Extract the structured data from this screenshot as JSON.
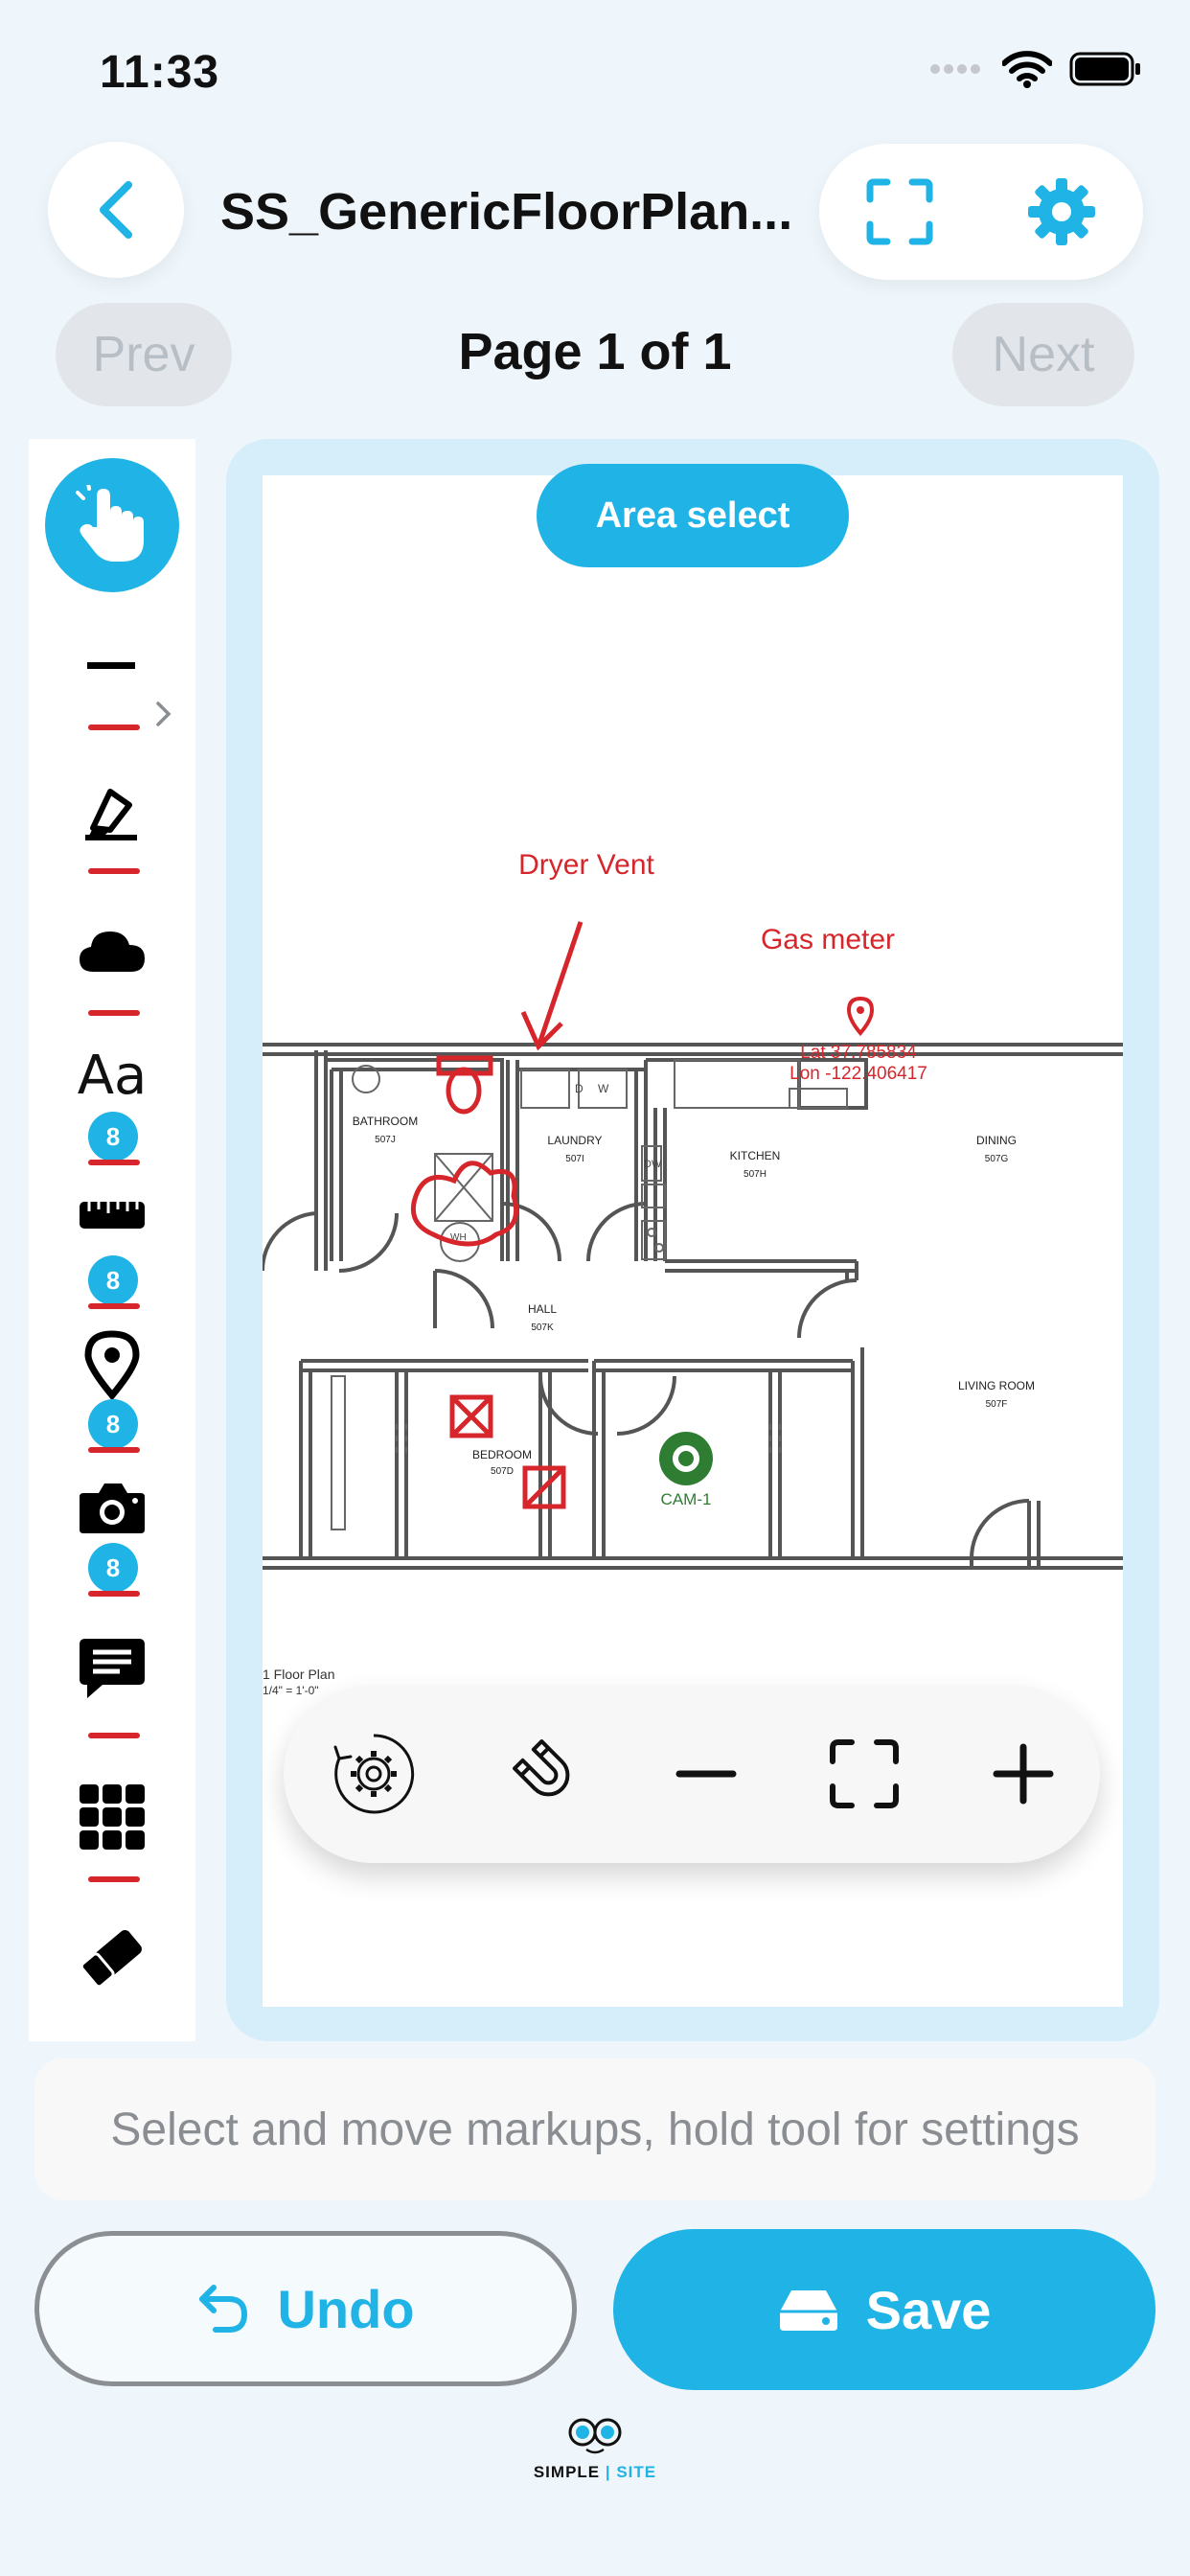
{
  "status_bar": {
    "time": "11:33"
  },
  "header": {
    "title": "SS_GenericFloorPlan...",
    "back_icon": "chevron-left-icon",
    "fullscreen_icon": "fullscreen-icon",
    "settings_icon": "gear-icon"
  },
  "pager": {
    "prev_label": "Prev",
    "page_label": "Page 1 of 1",
    "next_label": "Next"
  },
  "toolbar": {
    "tools": [
      {
        "name": "hand",
        "icon": "hand-pointer-icon",
        "selected": true
      },
      {
        "name": "line",
        "icon": "line-icon"
      },
      {
        "name": "highlighter",
        "icon": "highlighter-icon"
      },
      {
        "name": "cloud",
        "icon": "cloud-icon"
      },
      {
        "name": "text",
        "icon": "text-icon",
        "glyph": "Aa",
        "badge": "8"
      },
      {
        "name": "measure",
        "icon": "ruler-icon",
        "badge": "8"
      },
      {
        "name": "location",
        "icon": "map-pin-icon",
        "badge": "8"
      },
      {
        "name": "camera",
        "icon": "camera-icon",
        "badge": "8"
      },
      {
        "name": "comment",
        "icon": "comment-icon"
      },
      {
        "name": "grid",
        "icon": "grid-icon"
      },
      {
        "name": "eraser",
        "icon": "eraser-icon"
      }
    ],
    "accent": "#1fb3e6",
    "markup_color": "#d6262b"
  },
  "canvas": {
    "area_select_label": "Area select",
    "annotations": {
      "dryer_vent": "Dryer Vent",
      "gas_meter": "Gas meter",
      "lat": "Lat 37.785834",
      "lon": "Lon -122.406417",
      "camera_label": "CAM-1"
    },
    "rooms": [
      {
        "name": "BATHROOM",
        "code": "507J"
      },
      {
        "name": "LAUNDRY",
        "code": "507I"
      },
      {
        "name": "KITCHEN",
        "code": "507H"
      },
      {
        "name": "DINING",
        "code": "507G"
      },
      {
        "name": "HALL",
        "code": "507K"
      },
      {
        "name": "BEDROOM",
        "code": "507D"
      },
      {
        "name": "LIVING ROOM",
        "code": "507F"
      }
    ],
    "fixtures": {
      "dw": "DW",
      "wh": "WH",
      "d": "D",
      "w": "W"
    },
    "plan_title": "1 Floor Plan",
    "plan_scale": "1/4\" = 1'-0\""
  },
  "zoom_bar": {
    "rotate_icon": "rotate-gear-icon",
    "snap_icon": "magnet-icon",
    "zoom_out_icon": "minus-icon",
    "fit_icon": "fit-screen-icon",
    "zoom_in_icon": "plus-icon"
  },
  "hint": "Select and move markups, hold tool for settings",
  "actions": {
    "undo_label": "Undo",
    "save_label": "Save"
  },
  "logo": {
    "left": "SIMPLE",
    "separator": " | ",
    "right": "SITE"
  }
}
